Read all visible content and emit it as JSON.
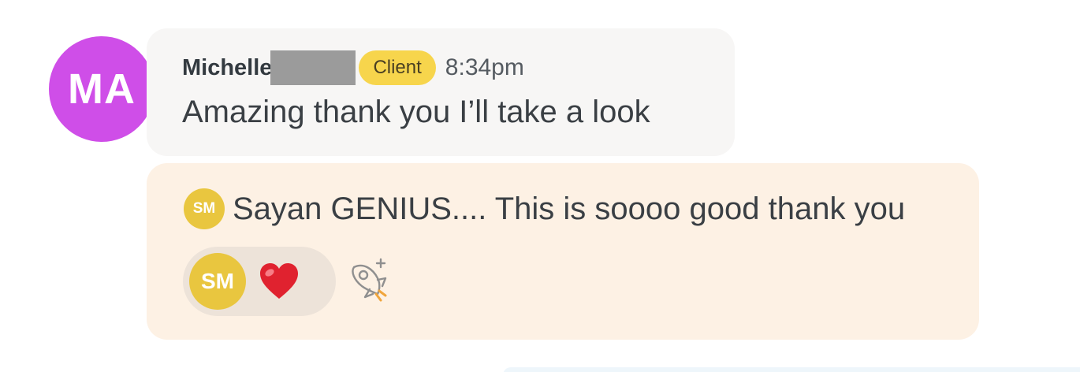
{
  "message": {
    "avatar_initials": "MA",
    "sender_first_name": "Michelle",
    "role_badge": "Client",
    "time": "8:34pm",
    "text": "Amazing thank you I’ll take a look"
  },
  "thread": {
    "avatar_initials": "SM",
    "text": "Sayan GENIUS.... This is soooo good thank you",
    "reaction": {
      "user_initials": "SM",
      "emoji_icon": "red-heart-icon"
    },
    "add_reaction_icon": "rocket-plus-icon"
  },
  "colors": {
    "avatar_main": "#cf4ee8",
    "avatar_sm": "#e9c63f",
    "badge": "#f7d54c",
    "thread_bg": "#fdf1e4"
  }
}
